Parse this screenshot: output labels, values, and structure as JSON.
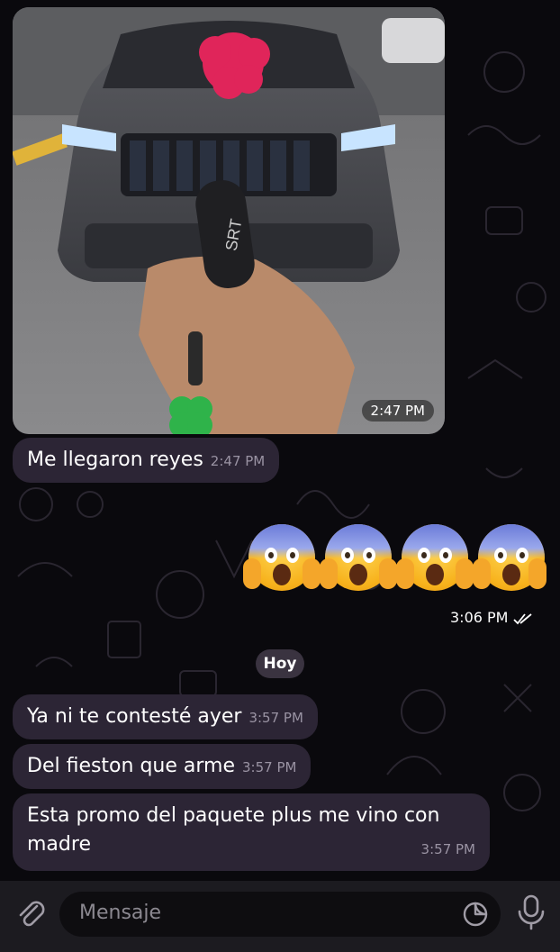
{
  "chat": {
    "photo_message": {
      "time": "2:47 PM"
    },
    "messages": [
      {
        "text": "Me llegaron reyes",
        "time": "2:47 PM",
        "direction": "incoming"
      },
      {
        "text": "Ya ni te contesté ayer",
        "time": "3:57 PM",
        "direction": "incoming"
      },
      {
        "text": "Del fieston que arme",
        "time": "3:57 PM",
        "direction": "incoming"
      },
      {
        "text": "Esta promo del paquete plus me vino con madre",
        "time": "3:57 PM",
        "direction": "incoming"
      }
    ],
    "sent_emoji_message": {
      "emoji_name": "face-screaming-in-fear",
      "count": 4,
      "time": "3:06 PM",
      "status_icon": "double-check-icon"
    },
    "date_separator": "Hoy"
  },
  "composer": {
    "placeholder": "Mensaje",
    "icons": [
      "paperclip-icon",
      "sticker-icon",
      "microphone-icon"
    ]
  },
  "colors": {
    "background": "#0a090d",
    "incoming_bubble": "#2c2535",
    "timestamp": "#9a93a3",
    "bottom_bar": "#1c1b20"
  }
}
